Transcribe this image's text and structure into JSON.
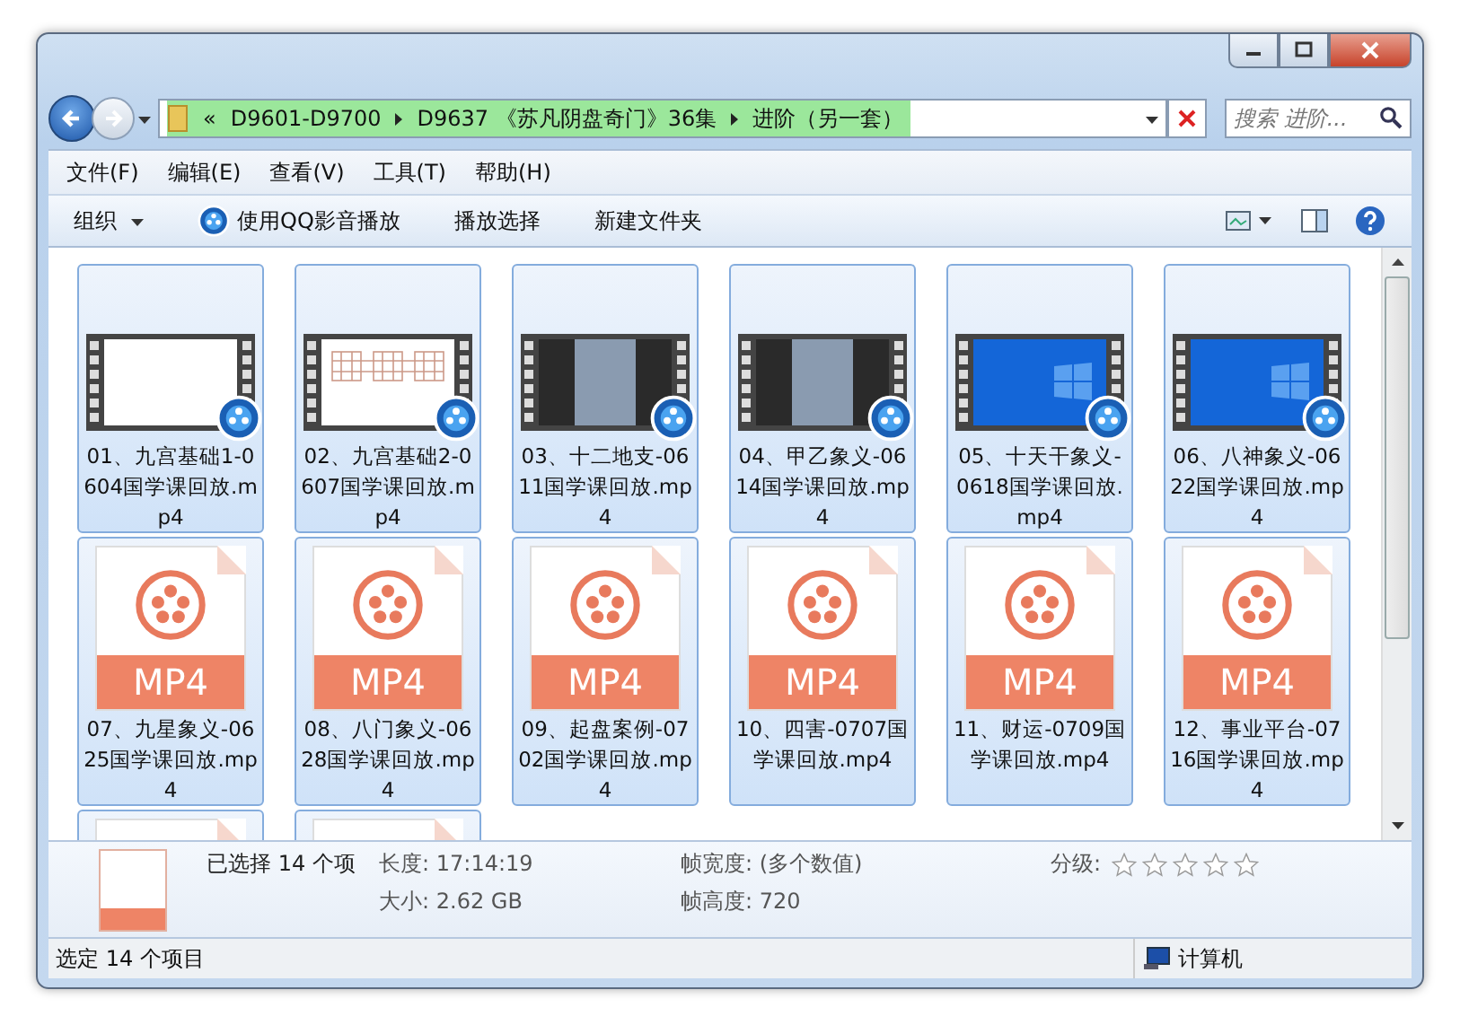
{
  "address_bar": {
    "overflow": "«",
    "path": [
      "D9601-D9700",
      "D9637 《苏凡阴盘奇门》36集",
      "进阶（另一套）"
    ],
    "search_placeholder": "搜索 进阶..."
  },
  "menu": [
    "文件(F)",
    "编辑(E)",
    "查看(V)",
    "工具(T)",
    "帮助(H)"
  ],
  "toolbar": [
    {
      "label": "组织",
      "kind": "dropdown"
    },
    {
      "label": "使用QQ影音播放",
      "kind": "player"
    },
    {
      "label": "播放选择",
      "kind": "plain"
    },
    {
      "label": "新建文件夹",
      "kind": "plain"
    }
  ],
  "files": [
    {
      "name": "01、九宫基础1-0604国学课回放.mp4",
      "kind": "blank",
      "selected": true
    },
    {
      "name": "02、九宫基础2-0607国学课回放.mp4",
      "kind": "grid",
      "selected": true
    },
    {
      "name": "03、十二地支-0611国学课回放.mp4",
      "kind": "photo",
      "selected": true
    },
    {
      "name": "04、甲乙象义-0614国学课回放.mp4",
      "kind": "photo",
      "selected": true
    },
    {
      "name": "05、十天干象义-0618国学课回放.mp4",
      "kind": "desktop",
      "selected": true
    },
    {
      "name": "06、八神象义-0622国学课回放.mp4",
      "kind": "desktop",
      "selected": true
    },
    {
      "name": "07、九星象义-0625国学课回放.mp4",
      "kind": "file",
      "badge": "MP4",
      "selected": true
    },
    {
      "name": "08、八门象义-0628国学课回放.mp4",
      "kind": "file",
      "badge": "MP4",
      "selected": true
    },
    {
      "name": "09、起盘案例-0702国学课回放.mp4",
      "kind": "file",
      "badge": "MP4",
      "selected": true
    },
    {
      "name": "10、四害-0707国学课回放.mp4",
      "kind": "file",
      "badge": "MP4",
      "selected": true
    },
    {
      "name": "11、财运-0709国学课回放.mp4",
      "kind": "file",
      "badge": "MP4",
      "selected": true
    },
    {
      "name": "12、事业平台-0716国学课回放.mp4",
      "kind": "file",
      "badge": "MP4",
      "selected": true
    },
    {
      "kind": "file",
      "selected": true
    },
    {
      "kind": "file",
      "selected": true
    }
  ],
  "details": {
    "selection": "已选择 14 个项",
    "fields": [
      {
        "label": "长度:",
        "value": "17:14:19"
      },
      {
        "label": "大小:",
        "value": "2.62 GB"
      },
      {
        "label": "帧宽度:",
        "value": "(多个数值)"
      },
      {
        "label": "帧高度:",
        "value": "720"
      }
    ],
    "rating_label": "分级:",
    "stars": 0
  },
  "status_bar": {
    "text": "选定 14 个项目",
    "zone": "计算机"
  }
}
